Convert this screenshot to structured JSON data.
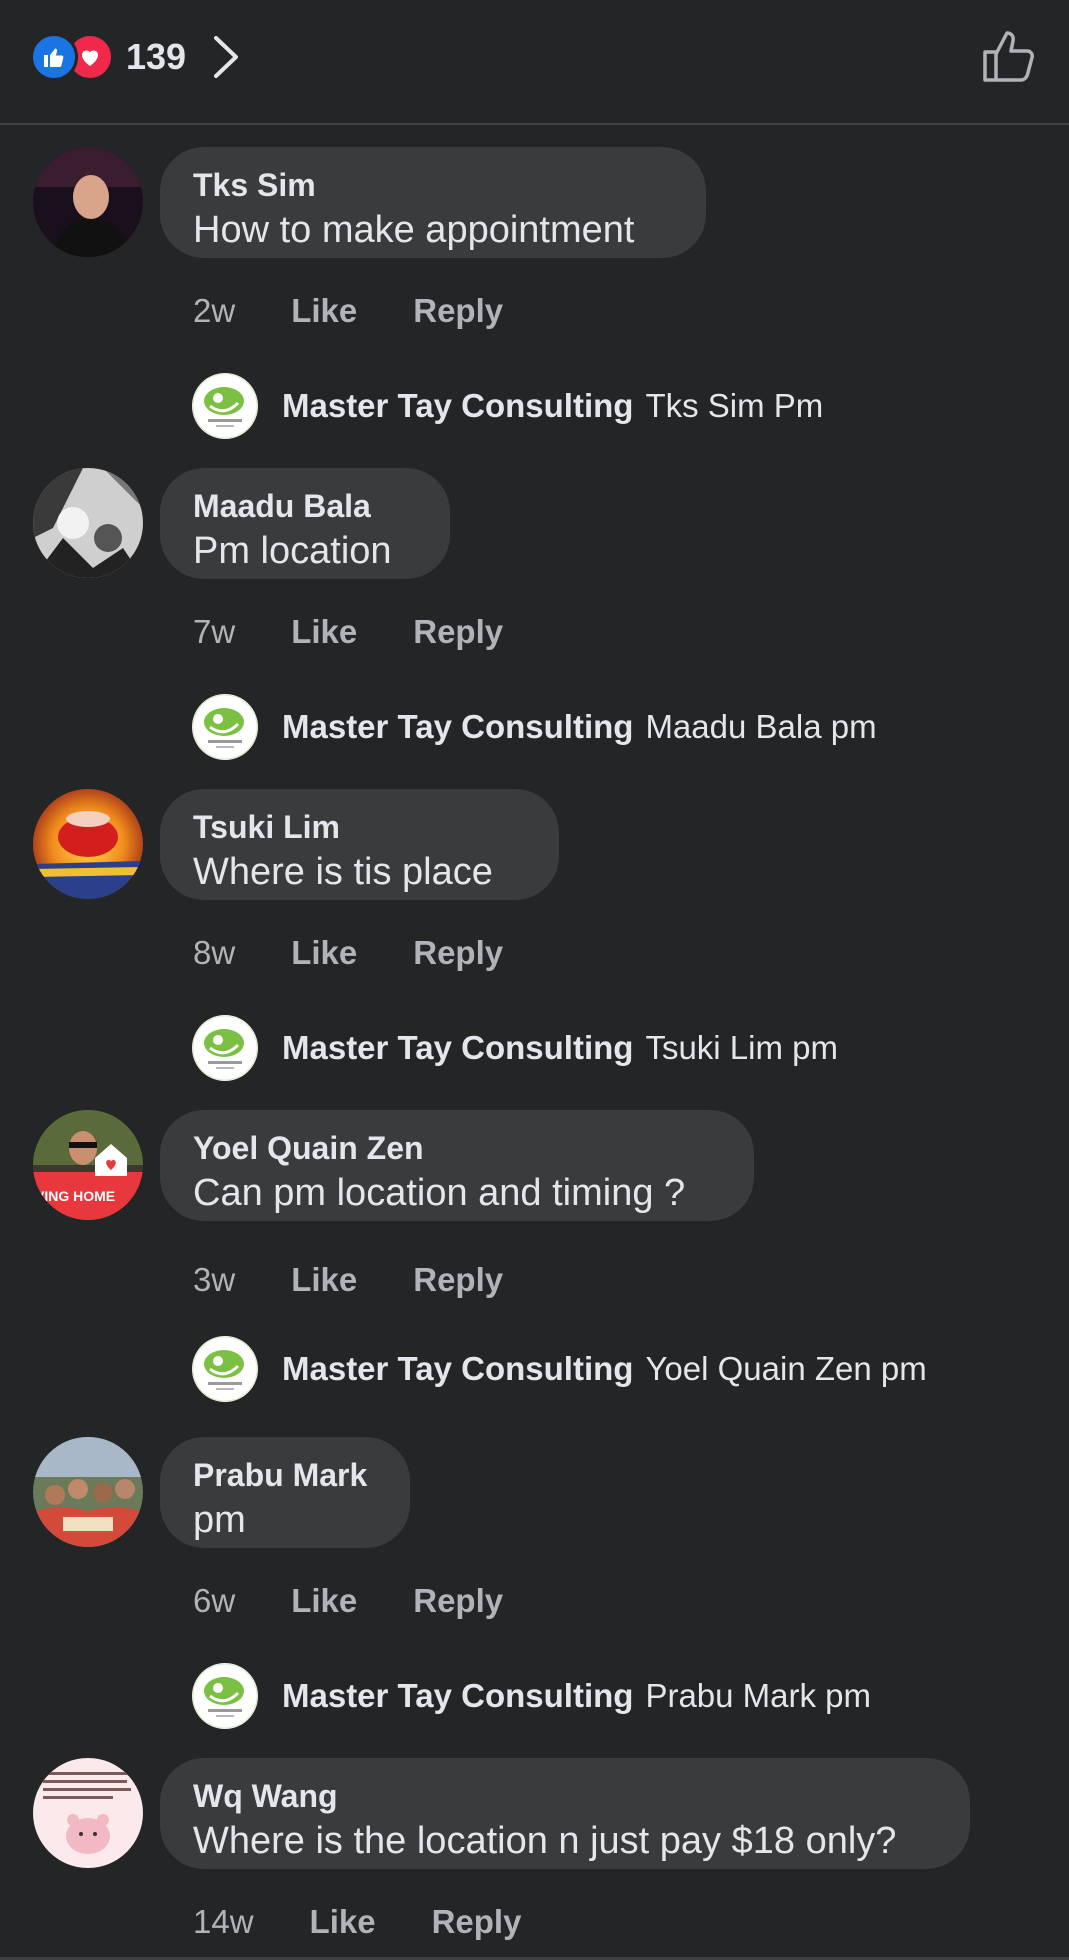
{
  "header": {
    "reaction_count": "139",
    "reaction_icons": [
      "like-icon",
      "love-icon"
    ],
    "chevron_icon": "chevron-right-icon",
    "like_button_icon": "thumbs-up-outline-icon"
  },
  "colors": {
    "background": "#242526",
    "bubble": "#3a3b3c",
    "like_blue": "#1b74e4",
    "love_red": "#f02849",
    "secondary_text": "#b0b3b8"
  },
  "comments": [
    {
      "author": "Tks Sim",
      "text": "How to make appointment",
      "time": "2w",
      "like_label": "Like",
      "reply_label": "Reply",
      "reply": {
        "author": "Master Tay Consulting",
        "text": "Tks Sim Pm"
      }
    },
    {
      "author": "Maadu Bala",
      "text": "Pm location",
      "time": "7w",
      "like_label": "Like",
      "reply_label": "Reply",
      "reply": {
        "author": "Master Tay Consulting",
        "text": "Maadu Bala pm"
      }
    },
    {
      "author": "Tsuki Lim",
      "text": "Where is tis place",
      "time": "8w",
      "like_label": "Like",
      "reply_label": "Reply",
      "reply": {
        "author": "Master Tay Consulting",
        "text": "Tsuki Lim pm"
      }
    },
    {
      "author": "Yoel Quain Zen",
      "text": "Can pm location and timing ?",
      "time": "3w",
      "like_label": "Like",
      "reply_label": "Reply",
      "avatar_text": "VING HOME",
      "reply": {
        "author": "Master Tay Consulting",
        "text": "Yoel Quain Zen pm"
      }
    },
    {
      "author": "Prabu Mark",
      "text": "pm",
      "time": "6w",
      "like_label": "Like",
      "reply_label": "Reply",
      "reply": {
        "author": "Master Tay Consulting",
        "text": "Prabu Mark pm"
      }
    },
    {
      "author": "Wq Wang",
      "text": "Where is the location n just pay $18 only?",
      "time": "14w",
      "like_label": "Like",
      "reply_label": "Reply"
    }
  ]
}
